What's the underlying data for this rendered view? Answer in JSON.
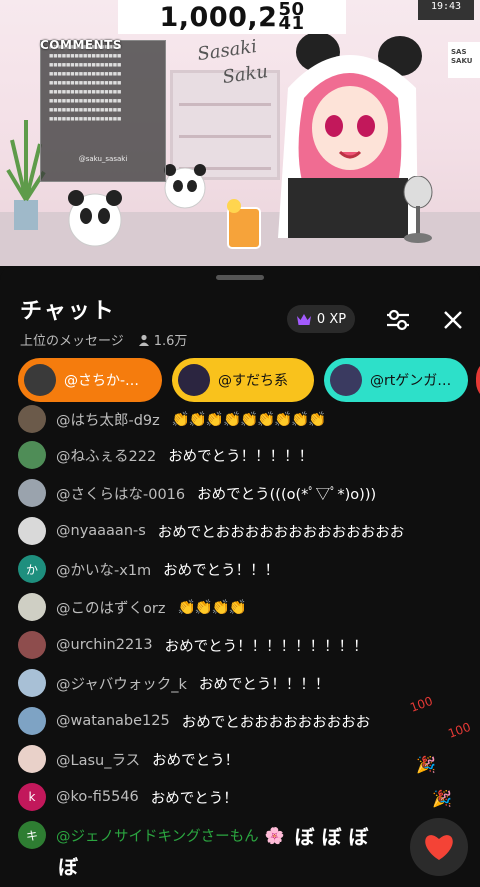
{
  "stream": {
    "counter_main": "1,000,2",
    "counter_roll_top": "50",
    "counter_roll_bottom": "41",
    "clock_time": "19:43",
    "comments_title": "COMMENTS",
    "comments_handle": "@saku_sasaki",
    "side_banner": "SAS SAKU",
    "logo_text": "Sasaki Saku"
  },
  "chat": {
    "title": "チャット",
    "subtitle": "上位のメッセージ",
    "viewers": "1.6万",
    "xp": "0 XP",
    "pinned": [
      {
        "label": "@さちか-…",
        "color": "#f57c0d"
      },
      {
        "label": "@すだち系",
        "color": "#f9c21c"
      },
      {
        "label": "@rtゲンガ…",
        "color": "#2de0c9"
      }
    ],
    "messages": [
      {
        "author": "@はち太郎-d9z",
        "text": "👏👏👏👏👏👏👏👏👏",
        "avatar_color": "#6b5a4a",
        "avatar_letter": ""
      },
      {
        "author": "@ねふぇる222",
        "text": "おめでとう！！！！！",
        "avatar_color": "#4f8d57",
        "avatar_letter": ""
      },
      {
        "author": "@さくらはな-0016",
        "text": "おめでとう(((o(*ﾟ▽ﾟ*)o)))",
        "avatar_color": "#9aa3ad",
        "avatar_letter": ""
      },
      {
        "author": "@nyaaaan-s",
        "text": "おめでとおおおおおおおおおおおおお",
        "avatar_color": "#d9d9d9",
        "avatar_letter": ""
      },
      {
        "author": "@かいな-x1m",
        "text": "おめでとう！！！",
        "avatar_color": "#1e8f7e",
        "avatar_letter": "か"
      },
      {
        "author": "@このはずくorz",
        "text": "👏👏👏👏",
        "avatar_color": "#cfcfc4",
        "avatar_letter": ""
      },
      {
        "author": "@urchin2213",
        "text": "おめでとう！！！！！！！！！",
        "avatar_color": "#8e4d4d",
        "avatar_letter": ""
      },
      {
        "author": "@ジャバウォック_k",
        "text": "おめでとう！！！！",
        "avatar_color": "#a8c0d6",
        "avatar_letter": ""
      },
      {
        "author": "@watanabe125",
        "text": "おめでとおおおおおおおおお",
        "avatar_color": "#7ea3c4",
        "avatar_letter": ""
      },
      {
        "author": "@Lasu_ラス",
        "text": "おめでとう！",
        "avatar_color": "#e9d1c9",
        "avatar_letter": ""
      },
      {
        "author": "@ko-fi5546",
        "text": "おめでとう！",
        "avatar_color": "#c2185b",
        "avatar_letter": "k"
      }
    ],
    "member_message": {
      "author": "@ジェノサイドキングさーもん",
      "text": "ぼ ぼ ぼ",
      "text2": "ぼ",
      "avatar_letter": "キ",
      "avatar_color": "#2e7d32"
    }
  }
}
